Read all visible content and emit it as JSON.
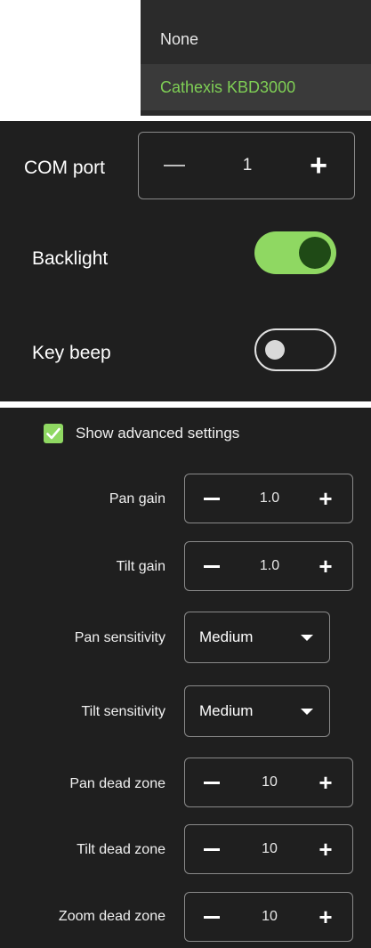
{
  "dropdown": {
    "options": [
      "None",
      "Cathexis KBD3000"
    ],
    "selected_index": 1
  },
  "basic": {
    "com_port": {
      "label": "COM port",
      "value": "1"
    },
    "backlight": {
      "label": "Backlight",
      "on": true
    },
    "key_beep": {
      "label": "Key beep",
      "on": false
    }
  },
  "advanced": {
    "show_label": "Show advanced settings",
    "show_checked": true,
    "pan_gain": {
      "label": "Pan gain",
      "value": "1.0"
    },
    "tilt_gain": {
      "label": "Tilt gain",
      "value": "1.0"
    },
    "pan_sensitivity": {
      "label": "Pan sensitivity",
      "value": "Medium"
    },
    "tilt_sensitivity": {
      "label": "Tilt sensitivity",
      "value": "Medium"
    },
    "pan_dead_zone": {
      "label": "Pan dead zone",
      "value": "10"
    },
    "tilt_dead_zone": {
      "label": "Tilt dead zone",
      "value": "10"
    },
    "zoom_dead_zone": {
      "label": "Zoom dead zone",
      "value": "10"
    }
  },
  "colors": {
    "accent": "#8fd862",
    "panel": "#1f1f1f",
    "selected_text": "#7fcf55"
  }
}
